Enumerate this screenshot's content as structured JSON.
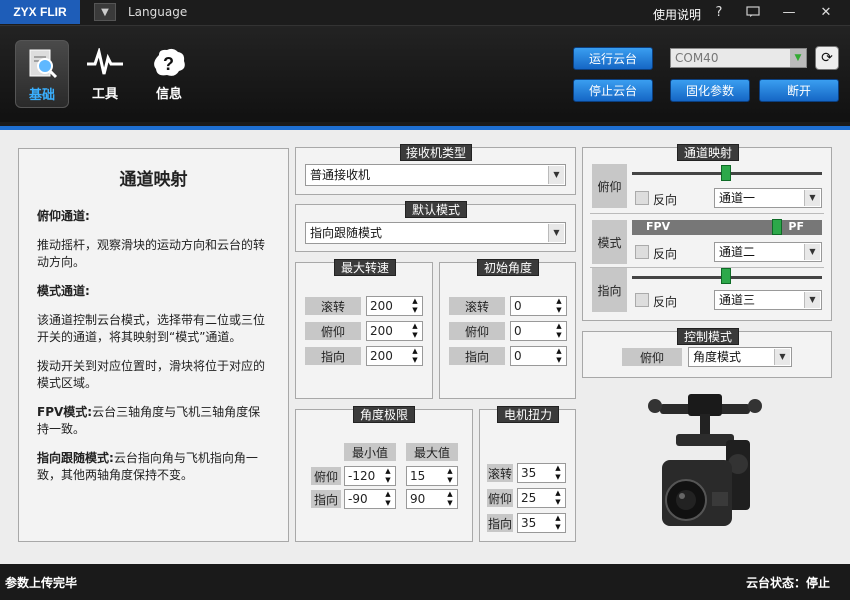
{
  "titlebar": {
    "brand": "ZYX FLIR",
    "language": "Language",
    "help": "使用说明",
    "help_icon": "?"
  },
  "nav": [
    {
      "label": "基础",
      "icon": "search-doc-icon"
    },
    {
      "label": "工具",
      "icon": "pulse-icon"
    },
    {
      "label": "信息",
      "icon": "info-cloud-icon"
    }
  ],
  "actions": {
    "run": "运行云台",
    "stop": "停止云台",
    "firmware": "固化参数",
    "disconnect": "断开",
    "port": "COM40"
  },
  "help_panel": {
    "title": "通道映射",
    "pitch_heading": "俯仰通道:",
    "pitch_text": "推动摇杆，观察滑块的运动方向和云台的转动方向。",
    "mode_heading": "模式通道:",
    "mode_text1": "该通道控制云台模式，选择带有二位或三位开关的通道，将其映射到“模式”通道。",
    "mode_text2": "拨动开关到对应位置时，滑块将位于对应的模式区域。",
    "fpv_heading": "FPV模式:",
    "fpv_text": "云台三轴角度与飞机三轴角度保持一致。",
    "follow_heading": "指向跟随模式:",
    "follow_text": "云台指向角与飞机指向角一致，其他两轴角度保持不变。"
  },
  "receiver": {
    "title": "接收机类型",
    "value": "普通接收机"
  },
  "default_mode": {
    "title": "默认模式",
    "value": "指向跟随模式"
  },
  "max_speed": {
    "title": "最大转速",
    "rows": [
      {
        "label": "滚转",
        "value": "200"
      },
      {
        "label": "俯仰",
        "value": "200"
      },
      {
        "label": "指向",
        "value": "200"
      }
    ]
  },
  "init_angle": {
    "title": "初始角度",
    "rows": [
      {
        "label": "滚转",
        "value": "0"
      },
      {
        "label": "俯仰",
        "value": "0"
      },
      {
        "label": "指向",
        "value": "0"
      }
    ]
  },
  "angle_limit": {
    "title": "角度极限",
    "min_label": "最小值",
    "max_label": "最大值",
    "rows": [
      {
        "label": "俯仰",
        "min": "-120",
        "max": "15"
      },
      {
        "label": "指向",
        "min": "-90",
        "max": "90"
      }
    ]
  },
  "motor_torque": {
    "title": "电机扭力",
    "rows": [
      {
        "label": "滚转",
        "value": "35"
      },
      {
        "label": "俯仰",
        "value": "25"
      },
      {
        "label": "指向",
        "value": "35"
      }
    ]
  },
  "channel_map": {
    "title": "通道映射",
    "reverse_label": "反向",
    "rows": [
      {
        "label": "俯仰",
        "channel": "通道一"
      },
      {
        "label": "模式",
        "channel": "通道二",
        "left_zone": "FPV",
        "right_zone": "PF"
      },
      {
        "label": "指向",
        "channel": "通道三"
      }
    ]
  },
  "control_mode": {
    "title": "控制模式",
    "label": "俯仰",
    "value": "角度模式"
  },
  "status": {
    "left": "参数上传完毕",
    "right": "云台状态：停止"
  },
  "colors": {
    "accent": "#1e6fd1",
    "brand": "#1e5db8",
    "slider": "#2da84a"
  }
}
